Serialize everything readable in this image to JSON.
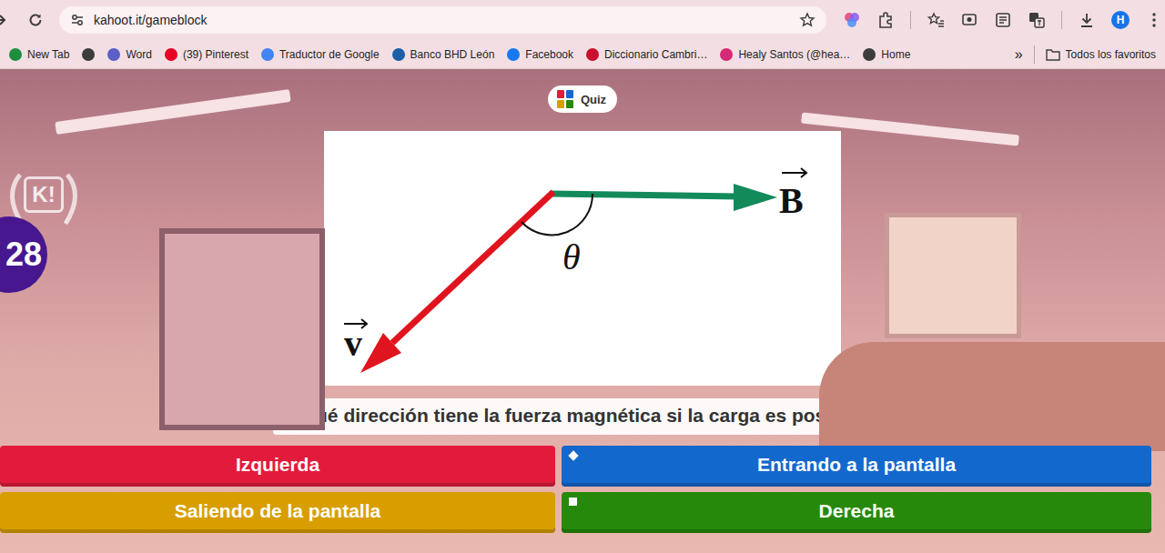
{
  "browser": {
    "url": "kahoot.it/gameblock",
    "avatar": "H",
    "bookmarks": [
      {
        "label": "New Tab",
        "color": "#1e8e3e"
      },
      {
        "label": "",
        "color": "#3c3c3c"
      },
      {
        "label": "Word",
        "color": "#5b5fc7"
      },
      {
        "label": "(39) Pinterest",
        "color": "#e60023"
      },
      {
        "label": "Traductor de Google",
        "color": "#4285f4"
      },
      {
        "label": "Banco BHD León",
        "color": "#1a5fa8"
      },
      {
        "label": "Facebook",
        "color": "#1877f2"
      },
      {
        "label": "Diccionario Cambri…",
        "color": "#c8102e"
      },
      {
        "label": "Healy Santos (@hea…",
        "color": "#d62976"
      },
      {
        "label": "Home",
        "color": "#3c3c3c"
      }
    ],
    "overflow": "»",
    "all_bookmarks": "Todos los favoritos"
  },
  "game": {
    "logo": "K!",
    "timer": "28",
    "badge": "Quiz",
    "diagram": {
      "field_label": "B",
      "velocity_label": "v",
      "angle_label": "θ"
    },
    "question": "¿Qué dirección tiene la fuerza magnética si la carga es positiva?",
    "answers": [
      {
        "label": "Izquierda",
        "color": "#e21b3c",
        "kind": "plain"
      },
      {
        "label": "Entrando a la pantalla",
        "color": "#1368ce",
        "kind": "diamond"
      },
      {
        "label": "Saliendo de la pantalla",
        "color": "#d89e00",
        "kind": "plain"
      },
      {
        "label": "Derecha",
        "color": "#26890c",
        "kind": "square"
      }
    ]
  }
}
